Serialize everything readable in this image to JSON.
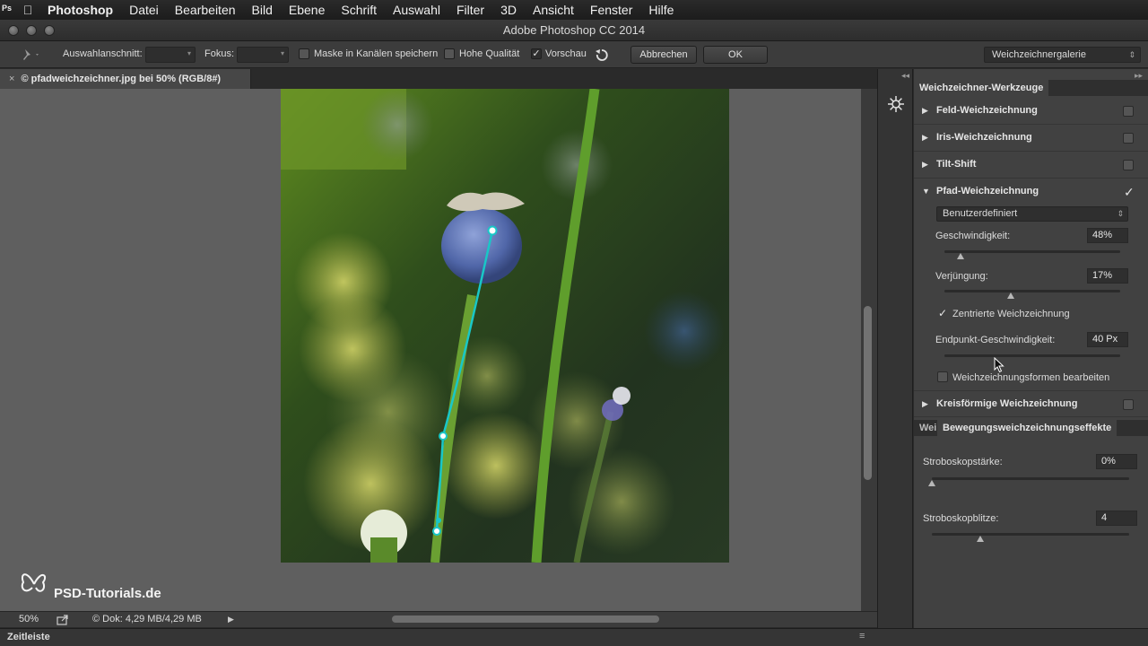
{
  "menubar": {
    "app": "Photoshop",
    "items": [
      "Datei",
      "Bearbeiten",
      "Bild",
      "Ebene",
      "Schrift",
      "Auswahl",
      "Filter",
      "3D",
      "Ansicht",
      "Fenster",
      "Hilfe"
    ]
  },
  "window": {
    "title": "Adobe Photoshop CC 2014"
  },
  "options": {
    "selection_label": "Auswahlanschnitt:",
    "focus_label": "Fokus:",
    "save_mask_label": "Maske in Kanälen speichern",
    "high_quality_label": "Hohe Qualität",
    "preview_label": "Vorschau",
    "cancel_label": "Abbrechen",
    "ok_label": "OK",
    "gallery_value": "Weichzeichnergalerie",
    "preview_checked": true
  },
  "document": {
    "tab_close": "×",
    "tab_title": "© pfadweichzeichner.jpg bei 50% (RGB/8#)"
  },
  "status": {
    "zoom": "50%",
    "doc_size": "© Dok: 4,29 MB/4,29 MB"
  },
  "timeline": {
    "label": "Zeitleiste"
  },
  "watermark": {
    "text": "PSD-Tutorials.de"
  },
  "panel": {
    "tools_tab": "Weichzeichner-Werkzeuge",
    "sections": [
      {
        "name": "Feld-Weichzeichnung",
        "expanded": false,
        "enabled": false
      },
      {
        "name": "Iris-Weichzeichnung",
        "expanded": false,
        "enabled": false
      },
      {
        "name": "Tilt-Shift",
        "expanded": false,
        "enabled": false
      },
      {
        "name": "Pfad-Weichzeichnung",
        "expanded": true,
        "enabled": true
      },
      {
        "name": "Kreisförmige Weichzeichnung",
        "expanded": false,
        "enabled": false
      }
    ],
    "path_blur": {
      "preset": "Benutzerdefiniert",
      "speed_label": "Geschwindigkeit:",
      "speed_value": "48%",
      "taper_label": "Verjüngung:",
      "taper_value": "17%",
      "centered_label": "Zentrierte Weichzeichnung",
      "centered_checked": true,
      "endpoint_label": "Endpunkt-Geschwindigkeit:",
      "endpoint_value": "40 Px",
      "edit_shapes_label": "Weichzeichnungsformen bearbeiten",
      "edit_shapes_checked": false
    },
    "effects_tabs": [
      "Wei",
      "Bewegungsweichzeichnungseffekte"
    ],
    "effects": {
      "strobe_strength_label": "Stroboskopstärke:",
      "strobe_strength_value": "0%",
      "strobe_flashes_label": "Stroboskopblitze:",
      "strobe_flashes_value": "4"
    }
  },
  "icons": {
    "apple": "apple-icon",
    "pin": "pin-tool-icon",
    "reset": "reset-icon",
    "blur_tool": "blur-gallery-icon"
  }
}
